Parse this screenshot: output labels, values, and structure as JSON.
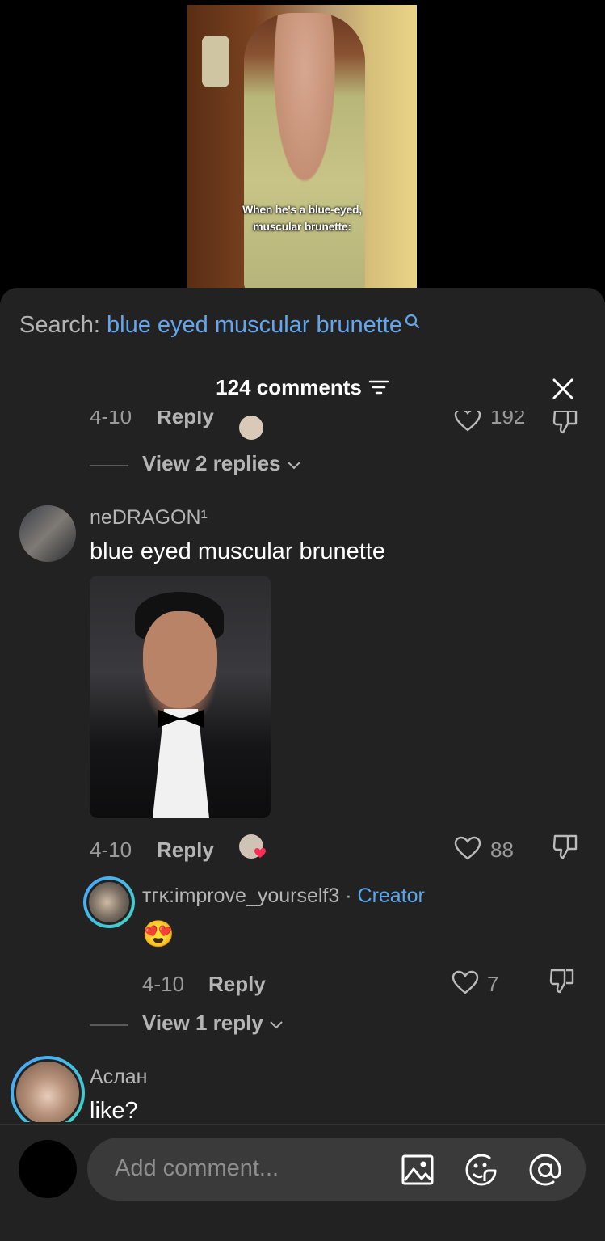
{
  "video": {
    "caption_line1": "When he's a blue-eyed,",
    "caption_line2": "muscular brunette:"
  },
  "search": {
    "prefix": "Search:",
    "term": "blue eyed muscular brunette",
    "icon": "search-icon"
  },
  "header": {
    "title": "124 comments",
    "filter_icon": "filter-icon",
    "close_icon": "close-icon"
  },
  "prev_comment": {
    "date": "4-10",
    "reply": "Reply",
    "likes": "192",
    "view_replies": "View 2 replies"
  },
  "comment1": {
    "username": "neDRAGON¹",
    "text": "blue eyed muscular brunette",
    "date": "4-10",
    "reply": "Reply",
    "likes": "88"
  },
  "reply1": {
    "username": "ᴛᴦᴋ:improve_yourself3",
    "separator": "·",
    "badge": "Creator",
    "text": "😍",
    "date": "4-10",
    "reply": "Reply",
    "likes": "7"
  },
  "comment1_more": {
    "view_replies": "View 1 reply"
  },
  "comment2": {
    "username": "Аслан",
    "text": "like?"
  },
  "composer": {
    "placeholder": "Add comment...",
    "icons": [
      "image-icon",
      "sticker-icon",
      "mention-icon"
    ]
  },
  "colors": {
    "accent": "#63a6f0",
    "background": "#222222",
    "like_heart": "#ff2d55"
  }
}
